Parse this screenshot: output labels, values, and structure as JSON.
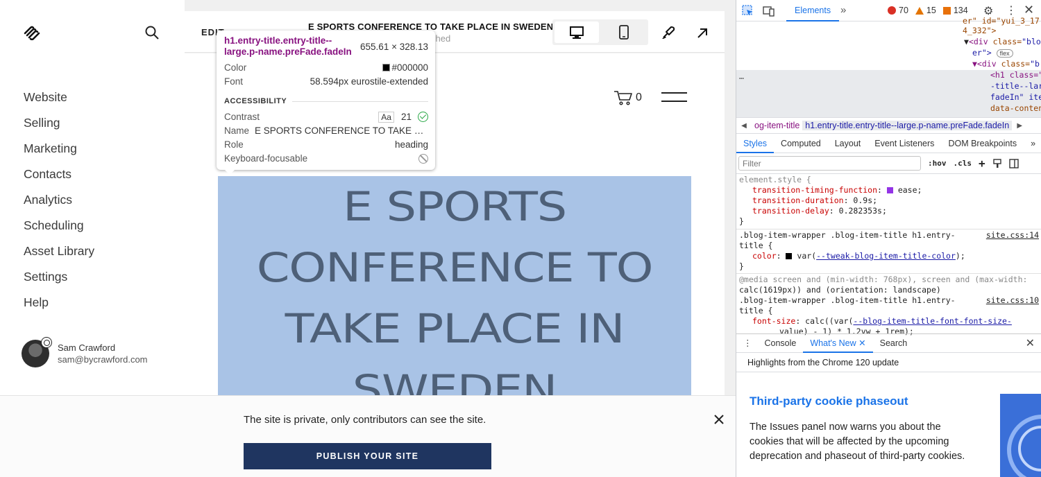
{
  "sidebar": {
    "nav": [
      "Website",
      "Selling",
      "Marketing",
      "Contacts",
      "Analytics",
      "Scheduling",
      "Asset Library",
      "Settings",
      "Help"
    ],
    "user": {
      "name": "Sam Crawford",
      "email": "sam@bycrawford.com"
    }
  },
  "editor": {
    "edit_label": "EDIT",
    "page_title": "E SPORTS CONFERENCE TO TAKE PLACE IN SWEDEN",
    "page_status": "shed"
  },
  "site": {
    "cart_count": "0",
    "headline": "E SPORTS CONFERENCE TO TAKE PLACE IN SWEDEN",
    "headline_lines": [
      "E SPORTS",
      "CONFERENCE TO",
      "TAKE PLACE IN",
      "SWEDEN"
    ],
    "headline_color": "#4e6078",
    "highlight_color": "#a9c3e6"
  },
  "tooltip": {
    "selector": "h1.entry-title.entry-title--large.p-name.preFade.fadeIn",
    "size": "655.61 × 328.13",
    "color_label": "Color",
    "color_value": "#000000",
    "font_label": "Font",
    "font_value": "58.594px eurostile-extended",
    "section": "ACCESSIBILITY",
    "contrast_label": "Contrast",
    "contrast_aa": "Aa",
    "contrast_value": "21",
    "name_label": "Name",
    "name_value": "E SPORTS CONFERENCE TO TAKE P…",
    "role_label": "Role",
    "role_value": "heading",
    "kbd_label": "Keyboard-focusable"
  },
  "banner": {
    "text": "The site is private, only contributors can see the site.",
    "publish_label": "PUBLISH YOUR SITE",
    "button_color": "#1f3560"
  },
  "devtools": {
    "tab_elements": "Elements",
    "errors": "70",
    "warnings": "15",
    "info": "134",
    "dom": {
      "l1": "4_332\">",
      "l2_tag": "<div",
      "l2_attr": "class=",
      "l2_val": "\"blo",
      "l3": "er\">",
      "l3_pill": "flex",
      "l4_tag": "▼<div",
      "l4_attr": "class=",
      "l4_val": "\"b",
      "l5": "<h1 class=\"",
      "l6": "-title--lar",
      "l7": "fadeIn\" ite",
      "l8": "data-conten",
      "top": "er\" id=\"yui_3_17"
    },
    "breadcrumbs": [
      "og-item-title",
      "h1.entry-title.entry-title--large.p-name.preFade.fadeIn"
    ],
    "panel_tabs": [
      "Styles",
      "Computed",
      "Layout",
      "Event Listeners",
      "DOM Breakpoints"
    ],
    "filter_placeholder": "Filter",
    "hov": ":hov",
    "cls": ".cls",
    "styles": {
      "r1_sel": "element.style {",
      "r1_p1": "transition-timing-function",
      "r1_v1": "ease;",
      "r1_p2": "transition-duration",
      "r1_v2": "0.9s;",
      "r1_p3": "transition-delay",
      "r1_v3": "0.282353s;",
      "r2_sel1": ".blog-item-wrapper .blog-item-title h1.entry-",
      "r2_sel2": "title {",
      "r2_src": "site.css:14",
      "r2_p1": "color",
      "r2_v1a": "var(",
      "r2_v1b": "--tweak-blog-item-title-color",
      "r2_v1c": ");",
      "r3_media1": "@media screen and (min-width: 768px), screen and (max-width:",
      "r3_media2": "calc(1619px)) and (orientation: landscape)",
      "r3_sel1": ".blog-item-wrapper .blog-item-title h1.entry-",
      "r3_sel2": "title {",
      "r3_src": "site.css:10",
      "r3_p1": "font-size",
      "r3_v1a": "calc((var(",
      "r3_v1b": "--blog-item-title-font-font-size-",
      "r3_v1c": "value) - 1) * 1.2vw + 1rem);",
      "close": "}"
    },
    "drawer_tabs": [
      "Console",
      "What's New",
      "Search"
    ],
    "whats_new_head": "Highlights from the Chrome 120 update",
    "wn_title": "Third-party cookie phaseout",
    "wn_body": "The Issues panel now warns you about the cookies that will be affected by the upcoming deprecation and phaseout of third-party cookies."
  }
}
